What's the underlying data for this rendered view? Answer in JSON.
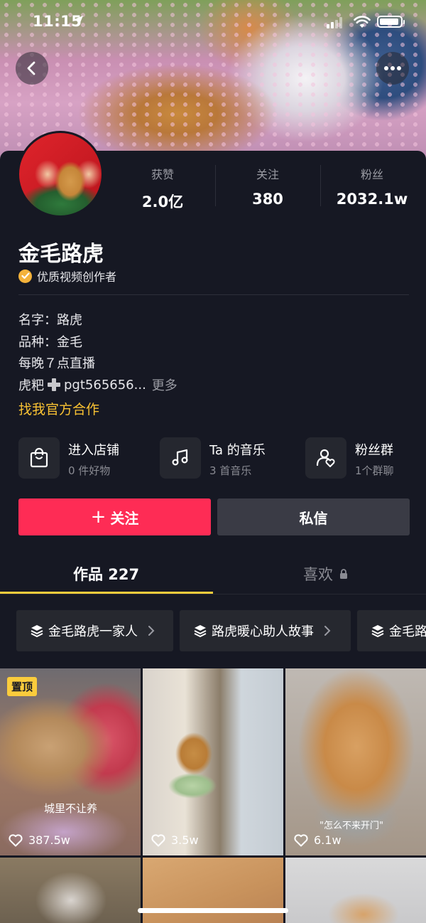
{
  "status_bar": {
    "time": "11:15"
  },
  "profile": {
    "name": "金毛路虎",
    "verified_label": "优质视频创作者",
    "stats": [
      {
        "label": "获赞",
        "value": "2.0亿"
      },
      {
        "label": "关注",
        "value": "380"
      },
      {
        "label": "粉丝",
        "value": "2032.1w"
      }
    ],
    "bio": {
      "line1": "名字：路虎",
      "line2": "品种：金毛",
      "line3": "每晚７点直播",
      "line4_prefix": "虎粑",
      "line4_text": "pgt565656...",
      "more": "更多"
    },
    "coop_link": "找我官方合作"
  },
  "features": [
    {
      "title": "进入店铺",
      "subtitle": "0 件好物",
      "icon": "shopping-bag-icon"
    },
    {
      "title": "Ta 的音乐",
      "subtitle": "3 首音乐",
      "icon": "music-note-icon"
    },
    {
      "title": "粉丝群",
      "subtitle": "1个群聊",
      "icon": "group-chat-icon"
    }
  ],
  "actions": {
    "follow": "关注",
    "message": "私信"
  },
  "tabs": {
    "works": "作品 227",
    "likes": "喜欢"
  },
  "collections": [
    "金毛路虎一家人",
    "路虎暖心助人故事",
    "金毛路"
  ],
  "videos": [
    {
      "pin": "置顶",
      "caption": "城里不让养",
      "likes": "387.5w"
    },
    {
      "caption": "",
      "likes": "3.5w"
    },
    {
      "caption": "\"怎么不来开门\"",
      "likes": "6.1w"
    }
  ],
  "colors": {
    "accent": "#fe2c55",
    "link": "#f9c233",
    "tab_indicator": "#facc3c",
    "background": "#161823"
  }
}
